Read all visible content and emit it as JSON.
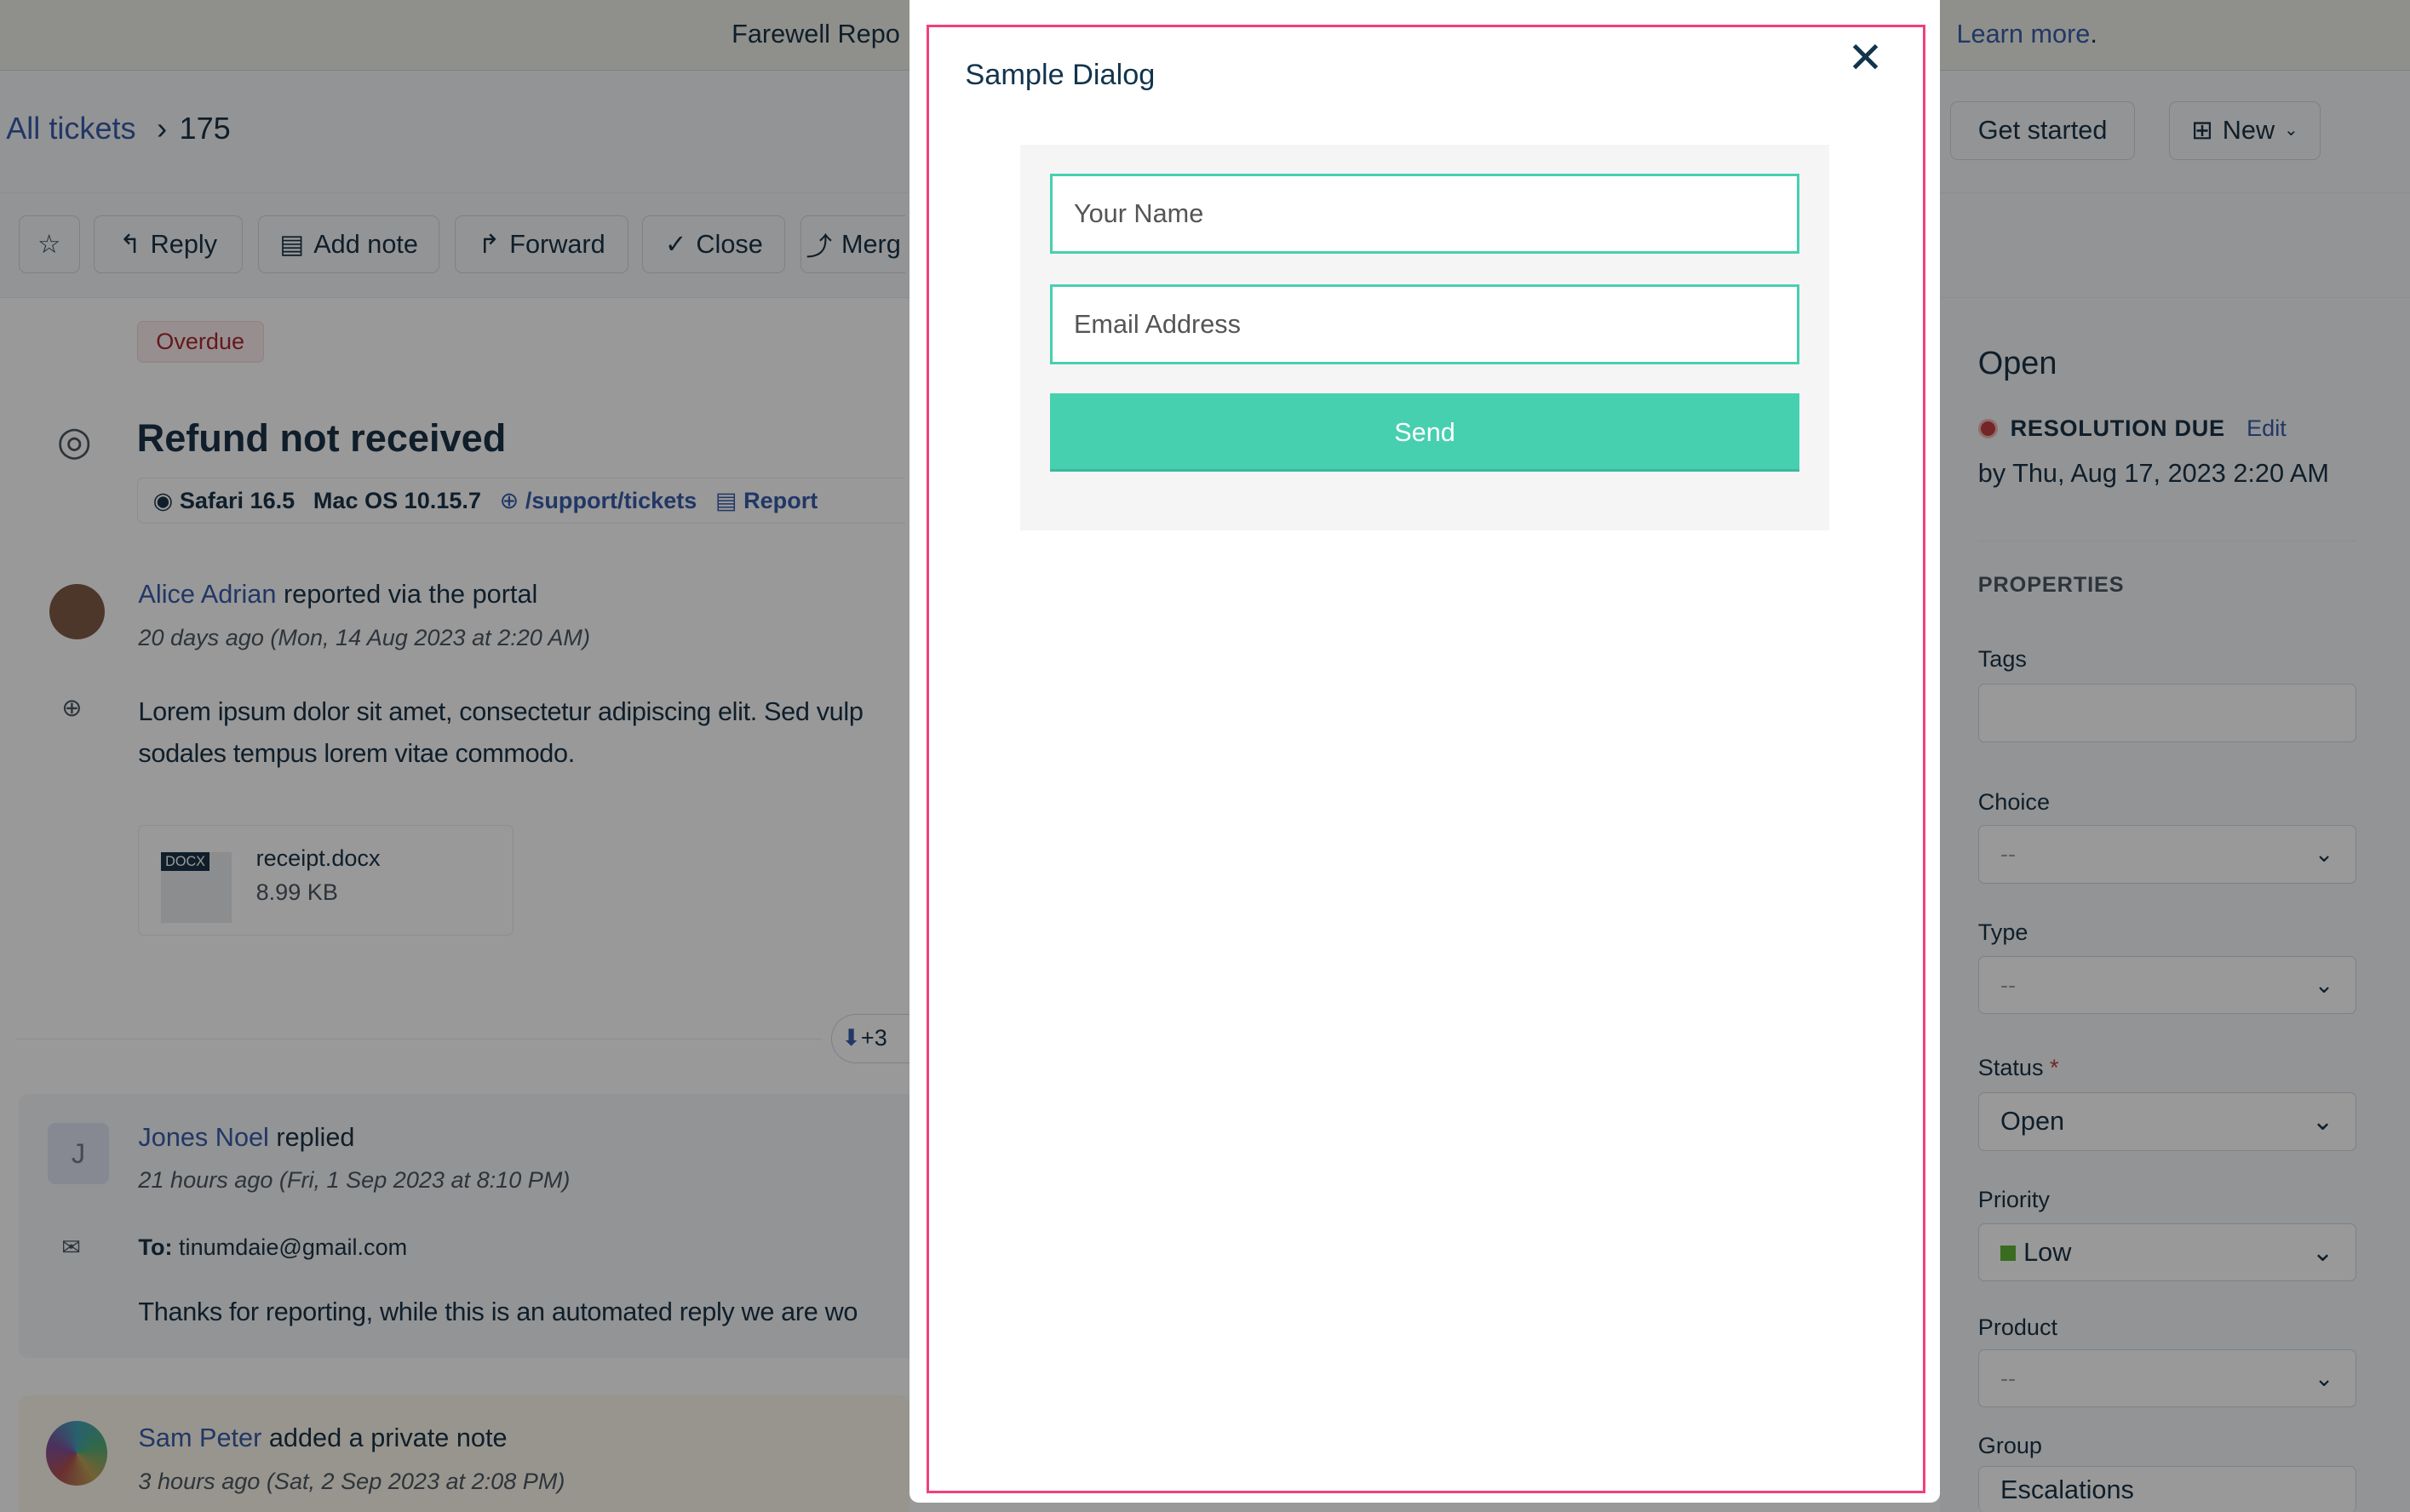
{
  "banner": {
    "text": "Farewell Repo",
    "link": "Learn more",
    "suffix": "."
  },
  "breadcrumb": {
    "root": "All tickets",
    "separator": "›",
    "current": "175"
  },
  "header_actions": {
    "get_started": "Get started",
    "new": "New"
  },
  "toolbar": {
    "reply": "Reply",
    "add_note": "Add note",
    "forward": "Forward",
    "close": "Close",
    "merge": "Merg"
  },
  "ticket": {
    "badge": "Overdue",
    "title": "Refund not received",
    "meta": [
      {
        "icon": "safari-icon",
        "text": "Safari 16.5"
      },
      {
        "icon": "apple-icon",
        "text": "Mac OS 10.15.7"
      },
      {
        "icon": "globe-icon",
        "text": "/support/tickets"
      },
      {
        "icon": "report-icon",
        "text": "Report"
      }
    ]
  },
  "messages": [
    {
      "author": "Alice Adrian",
      "action": "reported via the portal",
      "time": "20 days ago (Mon, 14 Aug 2023 at 2:20 AM)",
      "body": "Lorem ipsum dolor sit amet, consectetur adipiscing elit. Sed vulp",
      "body2": "sodales tempus lorem vitae commodo.",
      "attachment": {
        "badge": "DOCX",
        "name": "receipt.docx",
        "size": "8.99 KB"
      }
    },
    {
      "author": "Jones Noel",
      "initial": "J",
      "action": "replied",
      "time": "21 hours ago (Fri, 1 Sep 2023 at 8:10 PM)",
      "to_label": "To:",
      "to": "tinumdaie@gmail.com",
      "body": "Thanks for reporting, while this is an automated reply we are wo"
    },
    {
      "author": "Sam Peter",
      "action": "added a private note",
      "time": "3 hours ago (Sat, 2 Sep 2023 at 2:08 PM)"
    }
  ],
  "expand": {
    "count": "+3"
  },
  "sidebar": {
    "status": "Open",
    "due_label": "RESOLUTION DUE",
    "edit": "Edit",
    "due": "by Thu, Aug 17, 2023 2:20 AM",
    "properties": "PROPERTIES",
    "fields": {
      "tags": "Tags",
      "choice": "Choice",
      "choice_val": "--",
      "type": "Type",
      "type_val": "--",
      "status": "Status",
      "status_val": "Open",
      "priority": "Priority",
      "priority_val": "Low",
      "product": "Product",
      "product_val": "--",
      "group": "Group",
      "group_val": "Escalations"
    }
  },
  "dialog": {
    "title": "Sample Dialog",
    "name_placeholder": "Your Name",
    "email_placeholder": "Email Address",
    "send": "Send",
    "accent": "#47d0b0"
  }
}
